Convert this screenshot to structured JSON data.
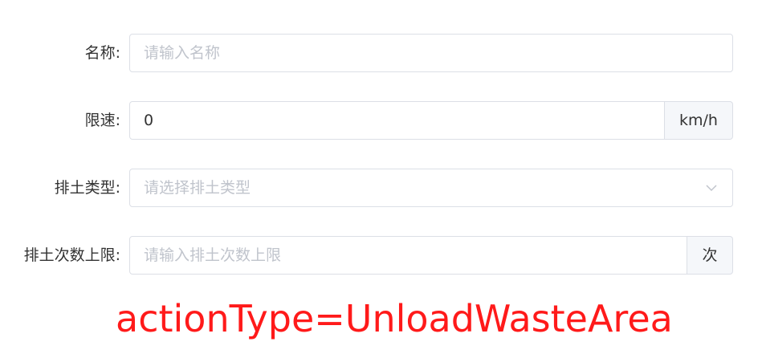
{
  "form": {
    "name": {
      "label": "名称:",
      "placeholder": "请输入名称"
    },
    "speed_limit": {
      "label": "限速:",
      "value": "0",
      "unit": "km/h"
    },
    "dump_type": {
      "label": "排土类型:",
      "placeholder": "请选择排土类型"
    },
    "dump_count_limit": {
      "label": "排土次数上限:",
      "placeholder": "请输入排土次数上限",
      "unit": "次"
    }
  },
  "annotation": "actionType=UnloadWasteArea",
  "colors": {
    "annotation": "#ff1a1a",
    "border": "#dcdfe6",
    "placeholder": "#c0c4cc",
    "addon_bg": "#f5f7fa"
  },
  "icons": {
    "select_arrow": "chevron-down-icon"
  }
}
